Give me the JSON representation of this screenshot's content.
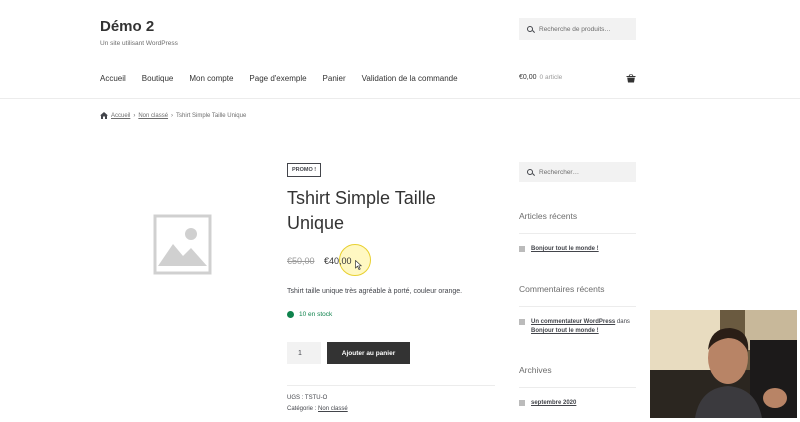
{
  "header": {
    "site_title": "Démo 2",
    "site_description": "Un site utilisant WordPress",
    "search_placeholder": "Recherche de produits…",
    "nav": [
      "Accueil",
      "Boutique",
      "Mon compte",
      "Page d'exemple",
      "Panier",
      "Validation de la commande"
    ],
    "cart_total": "€0,00",
    "cart_count": "0 article"
  },
  "breadcrumb": {
    "home": "Accueil",
    "separator": "›",
    "category": "Non classé",
    "current": "Tshirt Simple Taille Unique"
  },
  "product": {
    "badge": "PROMO !",
    "title": "Tshirt Simple Taille Unique",
    "old_price": "€50,00",
    "price": "€40,00",
    "description": "Tshirt taille unique très agréable à porté, couleur orange.",
    "stock": "10 en stock",
    "quantity": "1",
    "add_to_cart_label": "Ajouter au panier",
    "sku_label": "UGS :",
    "sku": "TSTU-O",
    "category_label": "Catégorie :",
    "category": "Non classé"
  },
  "sidebar": {
    "search_placeholder": "Rechercher…",
    "recent_posts_title": "Articles récents",
    "recent_post": "Bonjour tout le monde !",
    "recent_comments_title": "Commentaires récents",
    "comment_author": "Un commentateur WordPress",
    "comment_in": "dans",
    "comment_post": "Bonjour tout le monde !",
    "archives_title": "Archives",
    "archive_item": "septembre 2020"
  },
  "colors": {
    "stock_green": "#0f834d",
    "button_dark": "#333333",
    "highlight_yellow": "#e8d030"
  }
}
